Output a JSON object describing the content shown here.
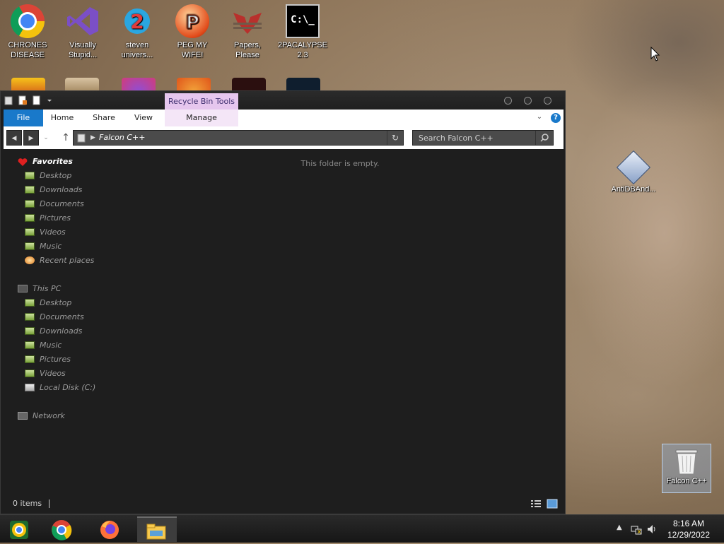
{
  "desktop": {
    "icons": [
      {
        "label": "CHRONES\nDISEASE",
        "icon": "chrome-icon"
      },
      {
        "label": "Visually\nStupid...",
        "icon": "visual-studio-icon"
      },
      {
        "label": "steven\nunivers...",
        "icon": "steven-universe-icon"
      },
      {
        "label": "PEG MY WIFE!",
        "icon": "peggle-icon"
      },
      {
        "label": "Papers,\nPlease",
        "icon": "papers-please-icon"
      },
      {
        "label": "2PACALYPSE\n2.3",
        "icon": "command-prompt-icon"
      }
    ],
    "right_icons": {
      "antidb": "AntiDBAnd...",
      "recycle_bin": "Falcon C++"
    }
  },
  "explorer": {
    "context_tab": "Recycle Bin Tools",
    "tabs": [
      "File",
      "Home",
      "Share",
      "View",
      "Manage"
    ],
    "address": "Falcon C++",
    "search_placeholder": "Search Falcon C++",
    "empty_message": "This folder is empty.",
    "status": "0 items",
    "nav": {
      "favorites": {
        "label": "Favorites",
        "items": [
          "Desktop",
          "Downloads",
          "Documents",
          "Pictures",
          "Videos",
          "Music",
          "Recent places"
        ]
      },
      "this_pc": {
        "label": "This PC",
        "items": [
          "Desktop",
          "Documents",
          "Downloads",
          "Music",
          "Pictures",
          "Videos",
          "Local Disk (C:)"
        ]
      },
      "network": "Network"
    }
  },
  "taskbar": {
    "apps": [
      "chrome-canary-icon",
      "chrome-icon",
      "firefox-icon",
      "file-explorer-icon"
    ],
    "time": "8:16 AM",
    "date": "12/29/2022"
  },
  "colors": {
    "file_tab": "#1979ca",
    "context_tab_bg": "#e6c6ee",
    "window_bg": "#1e1e1e",
    "help_icon": "#1979ca"
  }
}
